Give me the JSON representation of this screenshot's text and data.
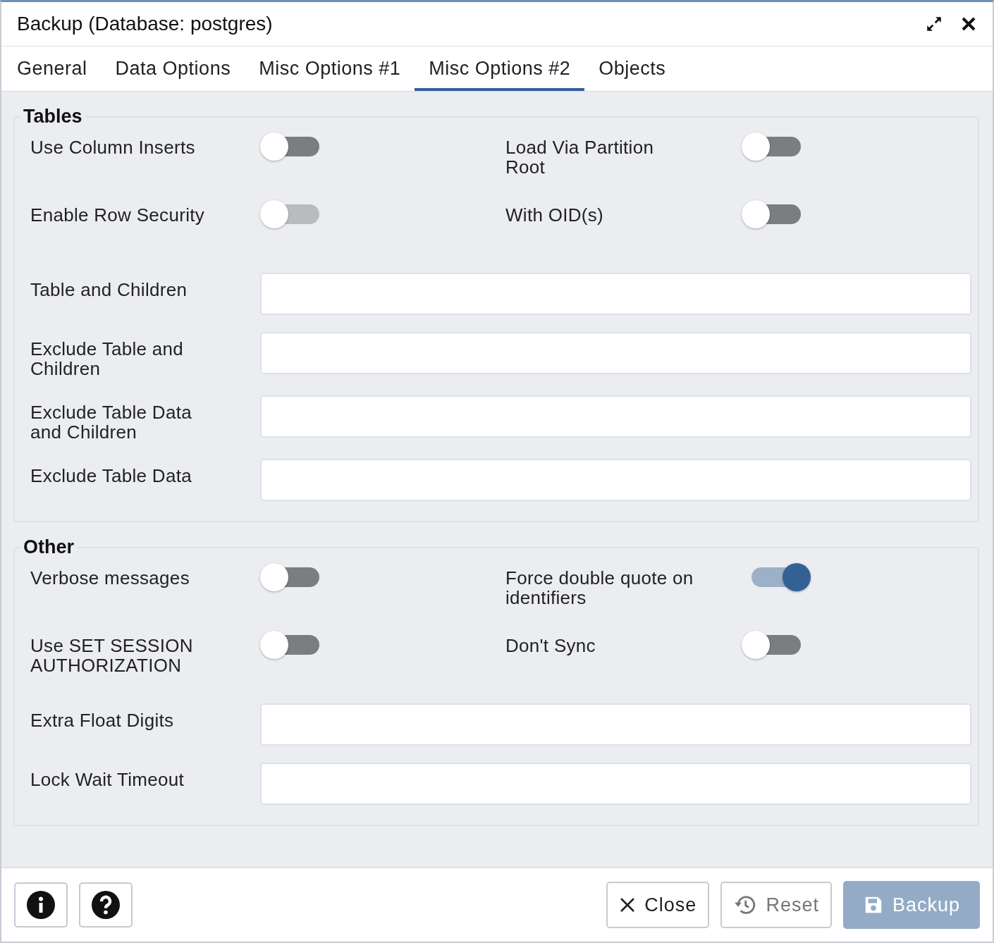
{
  "window": {
    "title": "Backup (Database: postgres)"
  },
  "tabs": [
    {
      "label": "General",
      "selected": false
    },
    {
      "label": "Data Options",
      "selected": false
    },
    {
      "label": "Misc Options #1",
      "selected": false
    },
    {
      "label": "Misc Options #2",
      "selected": true
    },
    {
      "label": "Objects",
      "selected": false
    }
  ],
  "sections": [
    {
      "title": "Tables",
      "rows": [
        {
          "kind": "switches",
          "items": [
            {
              "label": "Use Column Inserts",
              "on": false,
              "disabled": false
            },
            {
              "label": "Load Via Partition Root",
              "on": false,
              "disabled": false
            }
          ]
        },
        {
          "kind": "switches",
          "items": [
            {
              "label": "Enable Row Security",
              "on": false,
              "disabled": true
            },
            {
              "label": "With OID(s)",
              "on": false,
              "disabled": false
            }
          ]
        },
        {
          "kind": "input",
          "label": "Table and Children"
        },
        {
          "kind": "input",
          "label": "Exclude Table and Children"
        },
        {
          "kind": "input",
          "label": "Exclude Table Data and Children"
        },
        {
          "kind": "input",
          "label": "Exclude Table Data"
        }
      ]
    },
    {
      "title": "Other",
      "rows": [
        {
          "kind": "switches",
          "items": [
            {
              "label": "Verbose messages",
              "on": false,
              "disabled": false
            },
            {
              "label": "Force double quote on identifiers",
              "on": true,
              "disabled": false
            }
          ]
        },
        {
          "kind": "switches",
          "items": [
            {
              "label": "Use SET SESSION AUTHORIZATION",
              "on": false,
              "disabled": false
            },
            {
              "label": "Don't Sync",
              "on": false,
              "disabled": false
            }
          ]
        },
        {
          "kind": "input",
          "label": "Extra Float Digits"
        },
        {
          "kind": "input",
          "label": "Lock Wait Timeout"
        }
      ]
    }
  ],
  "footer": {
    "buttons": [
      {
        "kind": "close",
        "label": "Close",
        "disabled": false
      },
      {
        "kind": "reset",
        "label": "Reset",
        "disabled": true
      },
      {
        "kind": "save",
        "label": "Backup",
        "disabled": true
      }
    ]
  }
}
